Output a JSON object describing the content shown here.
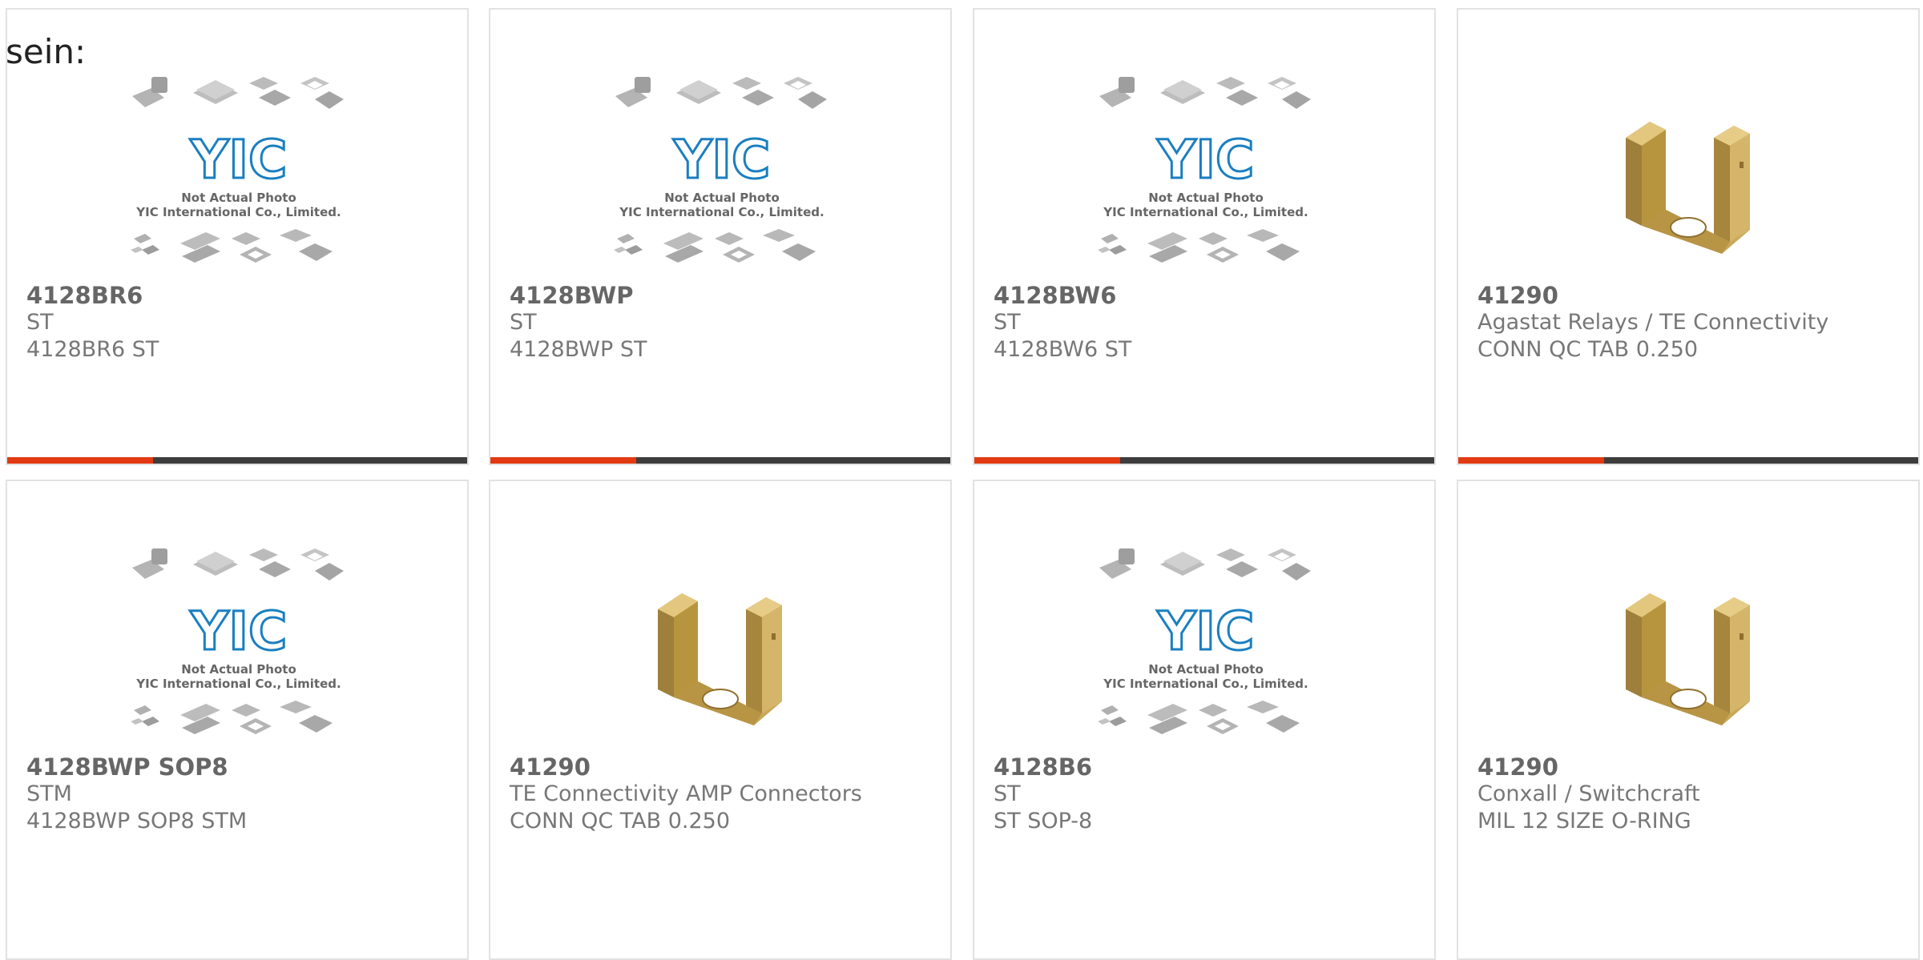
{
  "intro_text": "sein:",
  "placeholder": {
    "logo": "YIC",
    "line1": "Not Actual Photo",
    "line2": "YIC International Co., Limited."
  },
  "products": [
    {
      "part": "4128BR6",
      "maker": "ST",
      "desc": "4128BR6 ST",
      "image": "placeholder"
    },
    {
      "part": "4128BWP",
      "maker": "ST",
      "desc": "4128BWP ST",
      "image": "placeholder"
    },
    {
      "part": "4128BW6",
      "maker": "ST",
      "desc": "4128BW6 ST",
      "image": "placeholder"
    },
    {
      "part": "41290",
      "maker": "Agastat Relays / TE Connectivity",
      "desc": "CONN QC TAB 0.250",
      "image": "connector"
    },
    {
      "part": "4128BWP SOP8",
      "maker": "STM",
      "desc": "4128BWP SOP8 STM",
      "image": "placeholder"
    },
    {
      "part": "41290",
      "maker": "TE Connectivity AMP Connectors",
      "desc": "CONN QC TAB 0.250",
      "image": "connector"
    },
    {
      "part": "4128B6",
      "maker": "ST",
      "desc": "ST SOP-8",
      "image": "placeholder"
    },
    {
      "part": "41290",
      "maker": "Conxall / Switchcraft",
      "desc": "MIL 12 SIZE O-RING",
      "image": "connector"
    }
  ],
  "colors": {
    "accent": "#e23a13",
    "bar": "#3d3d3d",
    "logo": "#1a7fc0"
  }
}
